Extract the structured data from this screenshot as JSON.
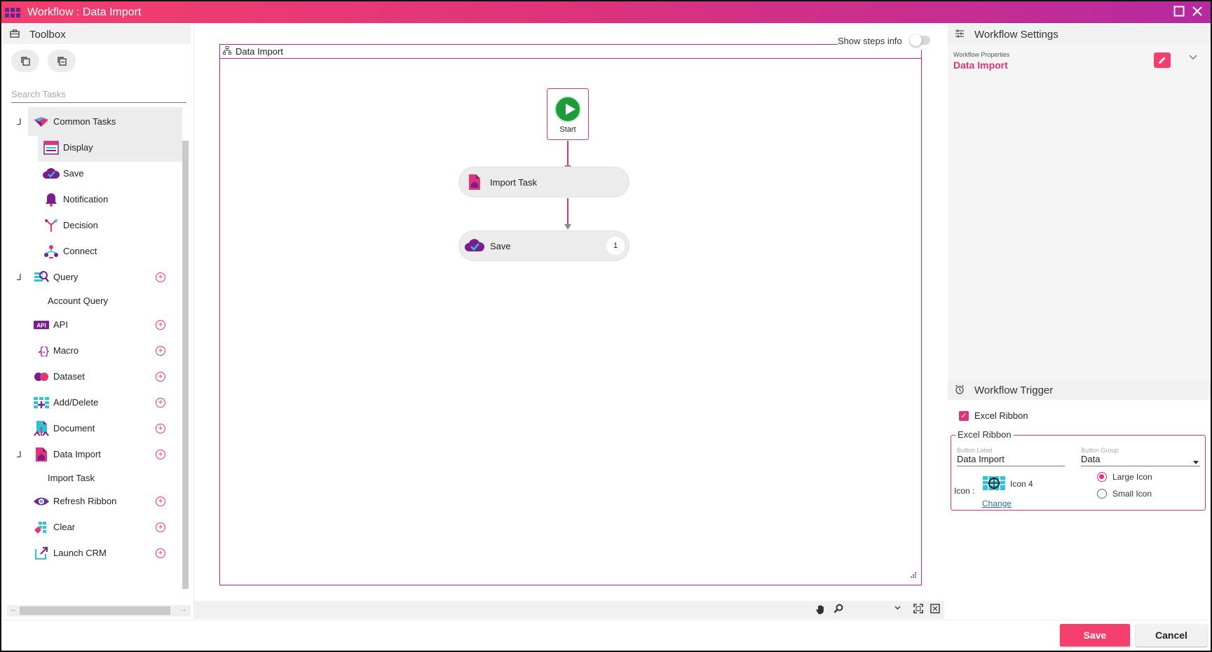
{
  "window": {
    "title": "Workflow : Data Import"
  },
  "toolbox": {
    "title": "Toolbox",
    "search_placeholder": "Search Tasks",
    "items": [
      {
        "label": "Common Tasks",
        "icon": "common-tasks-icon",
        "expanded": true
      },
      {
        "label": "Display",
        "icon": "display-icon"
      },
      {
        "label": "Save",
        "icon": "save-cloud-icon"
      },
      {
        "label": "Notification",
        "icon": "bell-icon"
      },
      {
        "label": "Decision",
        "icon": "decision-icon"
      },
      {
        "label": "Connect",
        "icon": "connect-icon"
      },
      {
        "label": "Query",
        "icon": "query-icon",
        "expanded": true
      },
      {
        "label": "Account Query"
      },
      {
        "label": "API",
        "icon": "api-icon"
      },
      {
        "label": "Macro",
        "icon": "macro-icon"
      },
      {
        "label": "Dataset",
        "icon": "dataset-icon"
      },
      {
        "label": "Add/Delete",
        "icon": "add-delete-icon"
      },
      {
        "label": "Document",
        "icon": "document-icon"
      },
      {
        "label": "Data Import",
        "icon": "data-import-icon",
        "expanded": true
      },
      {
        "label": "Import Task"
      },
      {
        "label": "Refresh Ribbon",
        "icon": "eye-icon"
      },
      {
        "label": "Clear",
        "icon": "clear-icon"
      },
      {
        "label": "Launch CRM",
        "icon": "launch-icon"
      }
    ]
  },
  "canvas": {
    "show_steps_label": "Show steps info",
    "show_steps_on": false,
    "workflow_name": "Data Import",
    "start_label": "Start",
    "nodes": [
      {
        "label": "Import Task"
      },
      {
        "label": "Save",
        "badge": "1"
      }
    ]
  },
  "settings": {
    "title": "Workflow Settings",
    "properties_label": "Workflow Properties",
    "properties_value": "Data Import"
  },
  "trigger": {
    "title": "Workflow Trigger",
    "excel_ribbon_label": "Excel Ribbon",
    "excel_ribbon_checked": true,
    "group_legend": "Excel Ribbon",
    "button_label_caption": "Button Label",
    "button_label_value": "Data Import",
    "button_group_caption": "Button Group",
    "button_group_value": "Data",
    "icon_caption": "Icon :",
    "icon_name": "Icon 4",
    "change_link": "Change",
    "large_icon_label": "Large Icon",
    "small_icon_label": "Small Icon",
    "icon_size_selected": "large"
  },
  "footer": {
    "save_label": "Save",
    "cancel_label": "Cancel"
  },
  "colors": {
    "accent": "#e0337a",
    "accent_bright": "#f43f6e",
    "purple": "#b52aa0",
    "start_green": "#1e9b3a"
  }
}
